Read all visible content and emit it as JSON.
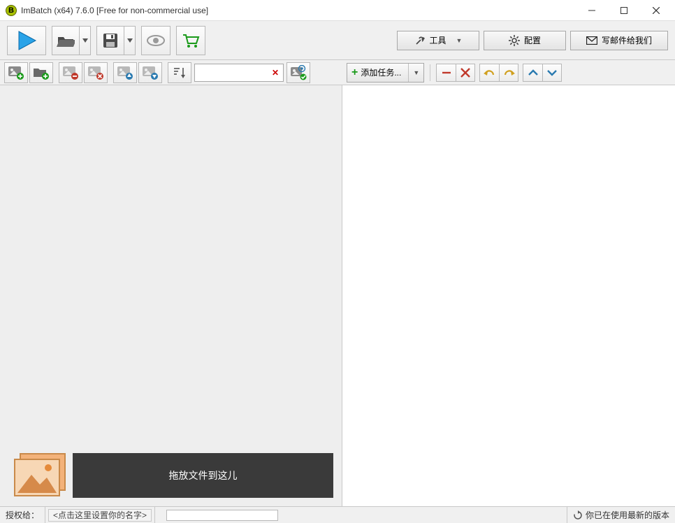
{
  "window": {
    "title": "ImBatch (x64) 7.6.0 [Free for non-commercial use]",
    "app_initial": "B"
  },
  "topbar": {
    "tools_label": "工具",
    "config_label": "配置",
    "email_label": "写邮件给我们"
  },
  "secbar": {
    "search_placeholder": ""
  },
  "right": {
    "add_task_label": "添加任务..."
  },
  "drop": {
    "hint": "拖放文件到这儿"
  },
  "status": {
    "licensed_to_label": "授权给：",
    "set_name_hint": "<点击这里设置你的名字>",
    "version_msg": "你已在使用最新的版本"
  }
}
